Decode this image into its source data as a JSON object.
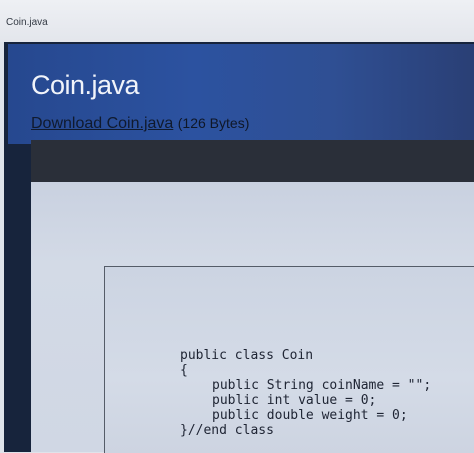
{
  "tab": {
    "title": "Coin.java"
  },
  "page": {
    "title": "Coin.java",
    "download_label": "Download Coin.java",
    "file_size": "(126 Bytes)"
  },
  "code": {
    "lines": [
      "public class Coin",
      "{",
      "public String coinName = \"\";",
      "public int value = 0;",
      "public double weight = 0;",
      "}//end class"
    ]
  }
}
